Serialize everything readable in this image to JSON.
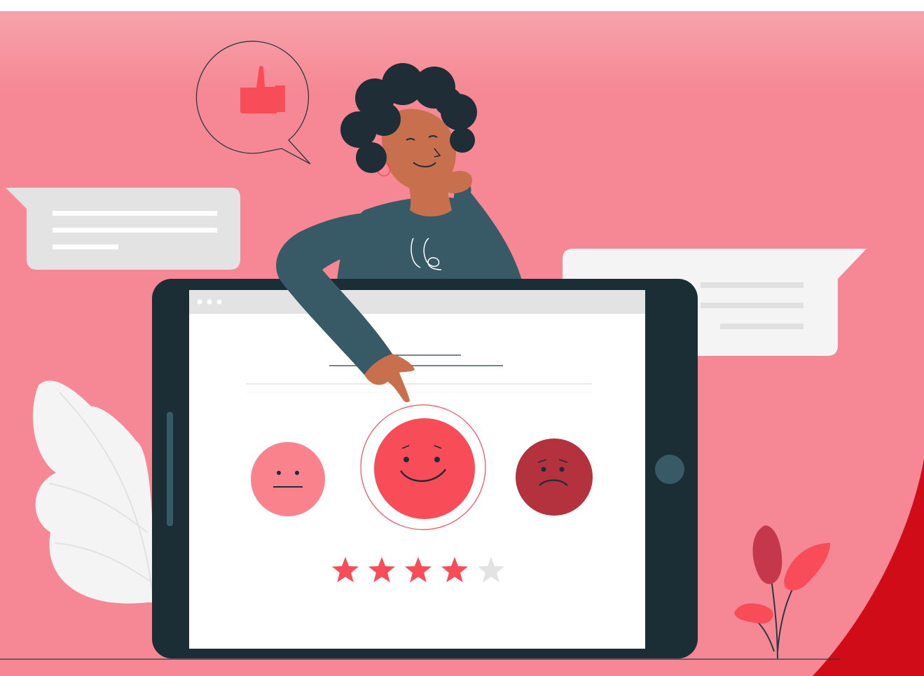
{
  "illustration": {
    "theme": "customer feedback rating",
    "colors": {
      "background": "#f58894",
      "accent_red": "#d10c19",
      "primary_face": "#f84c59",
      "neutral_face": "#f9828c",
      "sad_face": "#b3323d",
      "tablet_frame": "#1b2d35",
      "sweater": "#375a66",
      "skin": "#c86f4e",
      "hair": "#1e2d36",
      "bubble_grey": "#e3e3e3",
      "star_filled": "#f84c59",
      "star_empty": "#e3e3e3"
    },
    "rating": {
      "filled_stars": 4,
      "total_stars": 5,
      "selected_face": "happy"
    },
    "faces": [
      "neutral",
      "happy",
      "sad"
    ],
    "icons": [
      "thumbs-up-icon",
      "browser-dots-icon",
      "star-icon"
    ]
  }
}
